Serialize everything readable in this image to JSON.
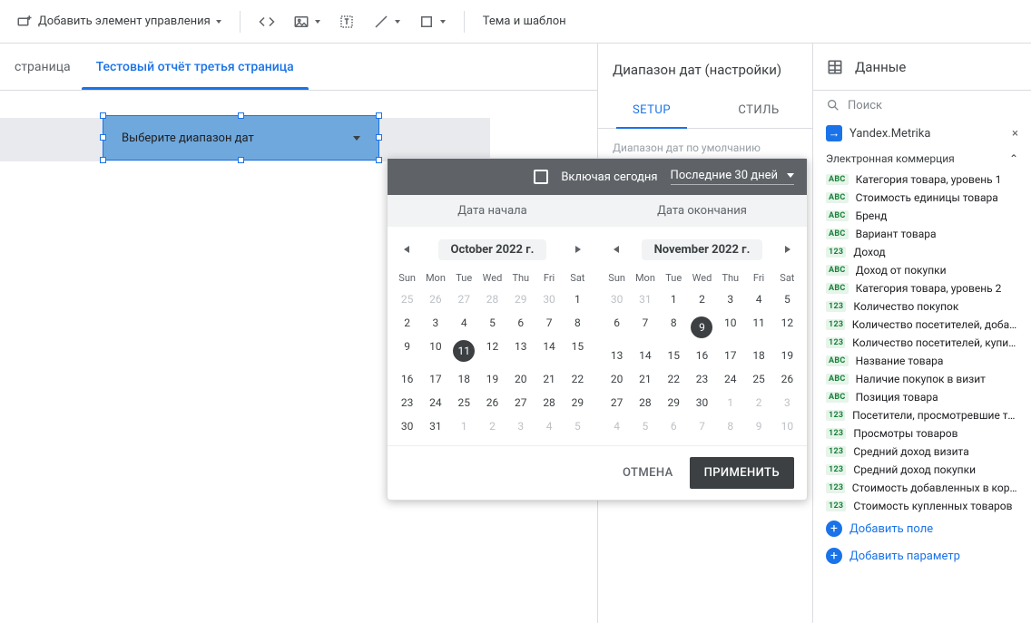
{
  "toolbar": {
    "add_control": "Добавить элемент управления",
    "theme": "Тема и шаблон"
  },
  "tabs": {
    "prev": "страница",
    "active": "Тестовый отчёт третья страница"
  },
  "widget": {
    "label": "Выберите диапазон дат"
  },
  "panel": {
    "title": "Диапазон дат (настройки)",
    "tab_setup": "SETUP",
    "tab_style": "СТИЛЬ",
    "sub": "Диапазон дат по умолчанию"
  },
  "data": {
    "header": "Данные",
    "search_placeholder": "Поиск",
    "source": "Yandex.Metrika",
    "group": "Электронная коммерция",
    "fields": [
      {
        "t": "abc",
        "n": "Категория товара, уровень 1"
      },
      {
        "t": "abc",
        "n": "Стоимость единицы товара"
      },
      {
        "t": "abc",
        "n": "Бренд"
      },
      {
        "t": "abc",
        "n": "Вариант товара"
      },
      {
        "t": "num",
        "n": "Доход"
      },
      {
        "t": "abc",
        "n": "Доход от покупки"
      },
      {
        "t": "abc",
        "n": "Категория товара, уровень 2"
      },
      {
        "t": "num",
        "n": "Количество покупок"
      },
      {
        "t": "num",
        "n": "Количество посетителей, добавив..."
      },
      {
        "t": "num",
        "n": "Количество посетителей, купивш..."
      },
      {
        "t": "abc",
        "n": "Название товара"
      },
      {
        "t": "abc",
        "n": "Наличие покупок в визит"
      },
      {
        "t": "abc",
        "n": "Позиция товара"
      },
      {
        "t": "num",
        "n": "Посетители, просмотревшие товар"
      },
      {
        "t": "num",
        "n": "Просмотры товаров"
      },
      {
        "t": "num",
        "n": "Средний доход визита"
      },
      {
        "t": "num",
        "n": "Средний доход покупки"
      },
      {
        "t": "num",
        "n": "Стоимость добавленных в корзин..."
      },
      {
        "t": "num",
        "n": "Стоимость купленных товаров"
      }
    ],
    "add_field": "Добавить поле",
    "add_param": "Добавить параметр"
  },
  "dp": {
    "include_today": "Включая сегодня",
    "preset": "Последние 30 дней",
    "left_label": "Дата начала",
    "right_label": "Дата окончания",
    "cancel": "ОТМЕНА",
    "apply": "ПРИМЕНИТЬ",
    "dow": [
      "Sun",
      "Mon",
      "Tue",
      "Wed",
      "Thu",
      "Fri",
      "Sat"
    ],
    "left": {
      "title": "October 2022 г.",
      "days": [
        {
          "d": 25,
          "o": true
        },
        {
          "d": 26,
          "o": true
        },
        {
          "d": 27,
          "o": true
        },
        {
          "d": 28,
          "o": true
        },
        {
          "d": 29,
          "o": true
        },
        {
          "d": 30,
          "o": true
        },
        {
          "d": 1
        },
        {
          "d": 2
        },
        {
          "d": 3
        },
        {
          "d": 4
        },
        {
          "d": 5
        },
        {
          "d": 6
        },
        {
          "d": 7
        },
        {
          "d": 8
        },
        {
          "d": 9
        },
        {
          "d": 10
        },
        {
          "d": 11,
          "today": true
        },
        {
          "d": 12
        },
        {
          "d": 13
        },
        {
          "d": 14
        },
        {
          "d": 15
        },
        {
          "d": 16
        },
        {
          "d": 17
        },
        {
          "d": 18
        },
        {
          "d": 19
        },
        {
          "d": 20
        },
        {
          "d": 21
        },
        {
          "d": 22
        },
        {
          "d": 23
        },
        {
          "d": 24
        },
        {
          "d": 25
        },
        {
          "d": 26
        },
        {
          "d": 27
        },
        {
          "d": 28
        },
        {
          "d": 29
        },
        {
          "d": 30
        },
        {
          "d": 31
        },
        {
          "d": 1,
          "o": true
        },
        {
          "d": 2,
          "o": true
        },
        {
          "d": 3,
          "o": true
        },
        {
          "d": 4,
          "o": true
        },
        {
          "d": 5,
          "o": true
        }
      ]
    },
    "right": {
      "title": "November 2022 г.",
      "days": [
        {
          "d": 30,
          "o": true
        },
        {
          "d": 31,
          "o": true
        },
        {
          "d": 1
        },
        {
          "d": 2
        },
        {
          "d": 3
        },
        {
          "d": 4
        },
        {
          "d": 5
        },
        {
          "d": 6
        },
        {
          "d": 7
        },
        {
          "d": 8
        },
        {
          "d": 9,
          "today": true
        },
        {
          "d": 10
        },
        {
          "d": 11
        },
        {
          "d": 12
        },
        {
          "d": 13
        },
        {
          "d": 14
        },
        {
          "d": 15
        },
        {
          "d": 16
        },
        {
          "d": 17
        },
        {
          "d": 18
        },
        {
          "d": 19
        },
        {
          "d": 20
        },
        {
          "d": 21
        },
        {
          "d": 22
        },
        {
          "d": 23
        },
        {
          "d": 24
        },
        {
          "d": 25
        },
        {
          "d": 26
        },
        {
          "d": 27
        },
        {
          "d": 28
        },
        {
          "d": 29
        },
        {
          "d": 30
        },
        {
          "d": 1,
          "o": true
        },
        {
          "d": 2,
          "o": true
        },
        {
          "d": 3,
          "o": true
        },
        {
          "d": 4,
          "o": true
        },
        {
          "d": 5,
          "o": true
        },
        {
          "d": 6,
          "o": true
        },
        {
          "d": 7,
          "o": true
        },
        {
          "d": 8,
          "o": true
        },
        {
          "d": 9,
          "o": true
        },
        {
          "d": 10,
          "o": true
        }
      ]
    }
  }
}
